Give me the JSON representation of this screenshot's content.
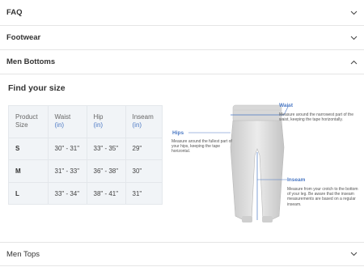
{
  "accordion": {
    "faq": {
      "label": "FAQ"
    },
    "footwear": {
      "label": "Footwear"
    },
    "bottoms": {
      "label": "Men Bottoms"
    },
    "tops": {
      "label": "Men Tops"
    }
  },
  "panel": {
    "title": "Find your size",
    "table": {
      "headers": [
        {
          "label": "Product",
          "unit": "Size"
        },
        {
          "label": "Waist",
          "unit": "(in)"
        },
        {
          "label": "Hip",
          "unit": "(in)"
        },
        {
          "label": "Inseam",
          "unit": "(in)"
        }
      ],
      "rows": [
        {
          "size": "S",
          "waist": "30\" - 31\"",
          "hip": "33\" - 35\"",
          "inseam": "29\""
        },
        {
          "size": "M",
          "waist": "31\" - 33\"",
          "hip": "36\" - 38\"",
          "inseam": "30\""
        },
        {
          "size": "L",
          "waist": "33\" - 34\"",
          "hip": "38\" - 41\"",
          "inseam": "31\""
        }
      ]
    },
    "diagram": {
      "waist": {
        "title": "Waist",
        "desc": "Measure around the narrowest part of the waist, keeping the tape horizontally."
      },
      "hips": {
        "title": "Hips",
        "desc": "Measure around the fullest part of your hips, keeping the tape horizontal."
      },
      "inseam": {
        "title": "Inseam",
        "desc": "Measure from your crotch to the bottom of your leg. Be aware that the inseam measurements are based on a regular inseam."
      }
    }
  },
  "colors": {
    "accent": "#4a78c4",
    "table_bg": "#f1f4f7",
    "divider": "#e5e5e5"
  }
}
